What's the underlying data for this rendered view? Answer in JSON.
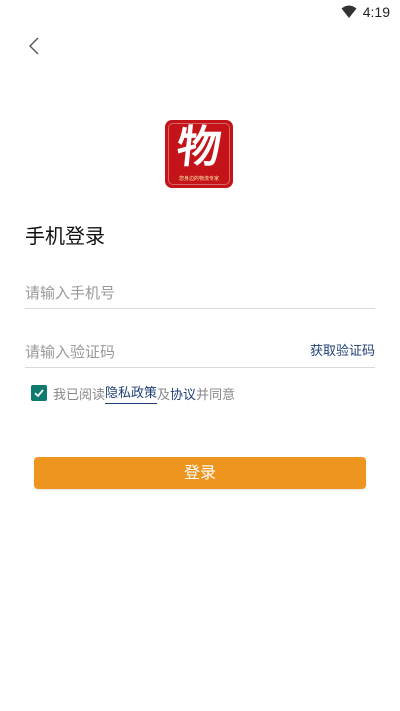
{
  "status_bar": {
    "time": "4:19",
    "icons": [
      "wifi-icon"
    ]
  },
  "nav": {
    "back_icon": "chevron-left-icon"
  },
  "logo": {
    "char": "物",
    "slogan": "您身边的物流专家",
    "colors": {
      "background": "#c4141a",
      "text": "#ffffff"
    }
  },
  "login": {
    "title": "手机登录",
    "phone_placeholder": "请输入手机号",
    "code_placeholder": "请输入验证码",
    "get_code_label": "获取验证码",
    "agree": {
      "checked": true,
      "prefix": "我已阅读",
      "privacy_link": "隐私政策",
      "and": "及",
      "agreement_link": "协议",
      "suffix": "并同意"
    },
    "submit_label": "登录"
  },
  "colors": {
    "accent": "#ee9520",
    "link": "#1f3f77",
    "checkbox": "#0d7a6f",
    "placeholder": "#999999"
  }
}
